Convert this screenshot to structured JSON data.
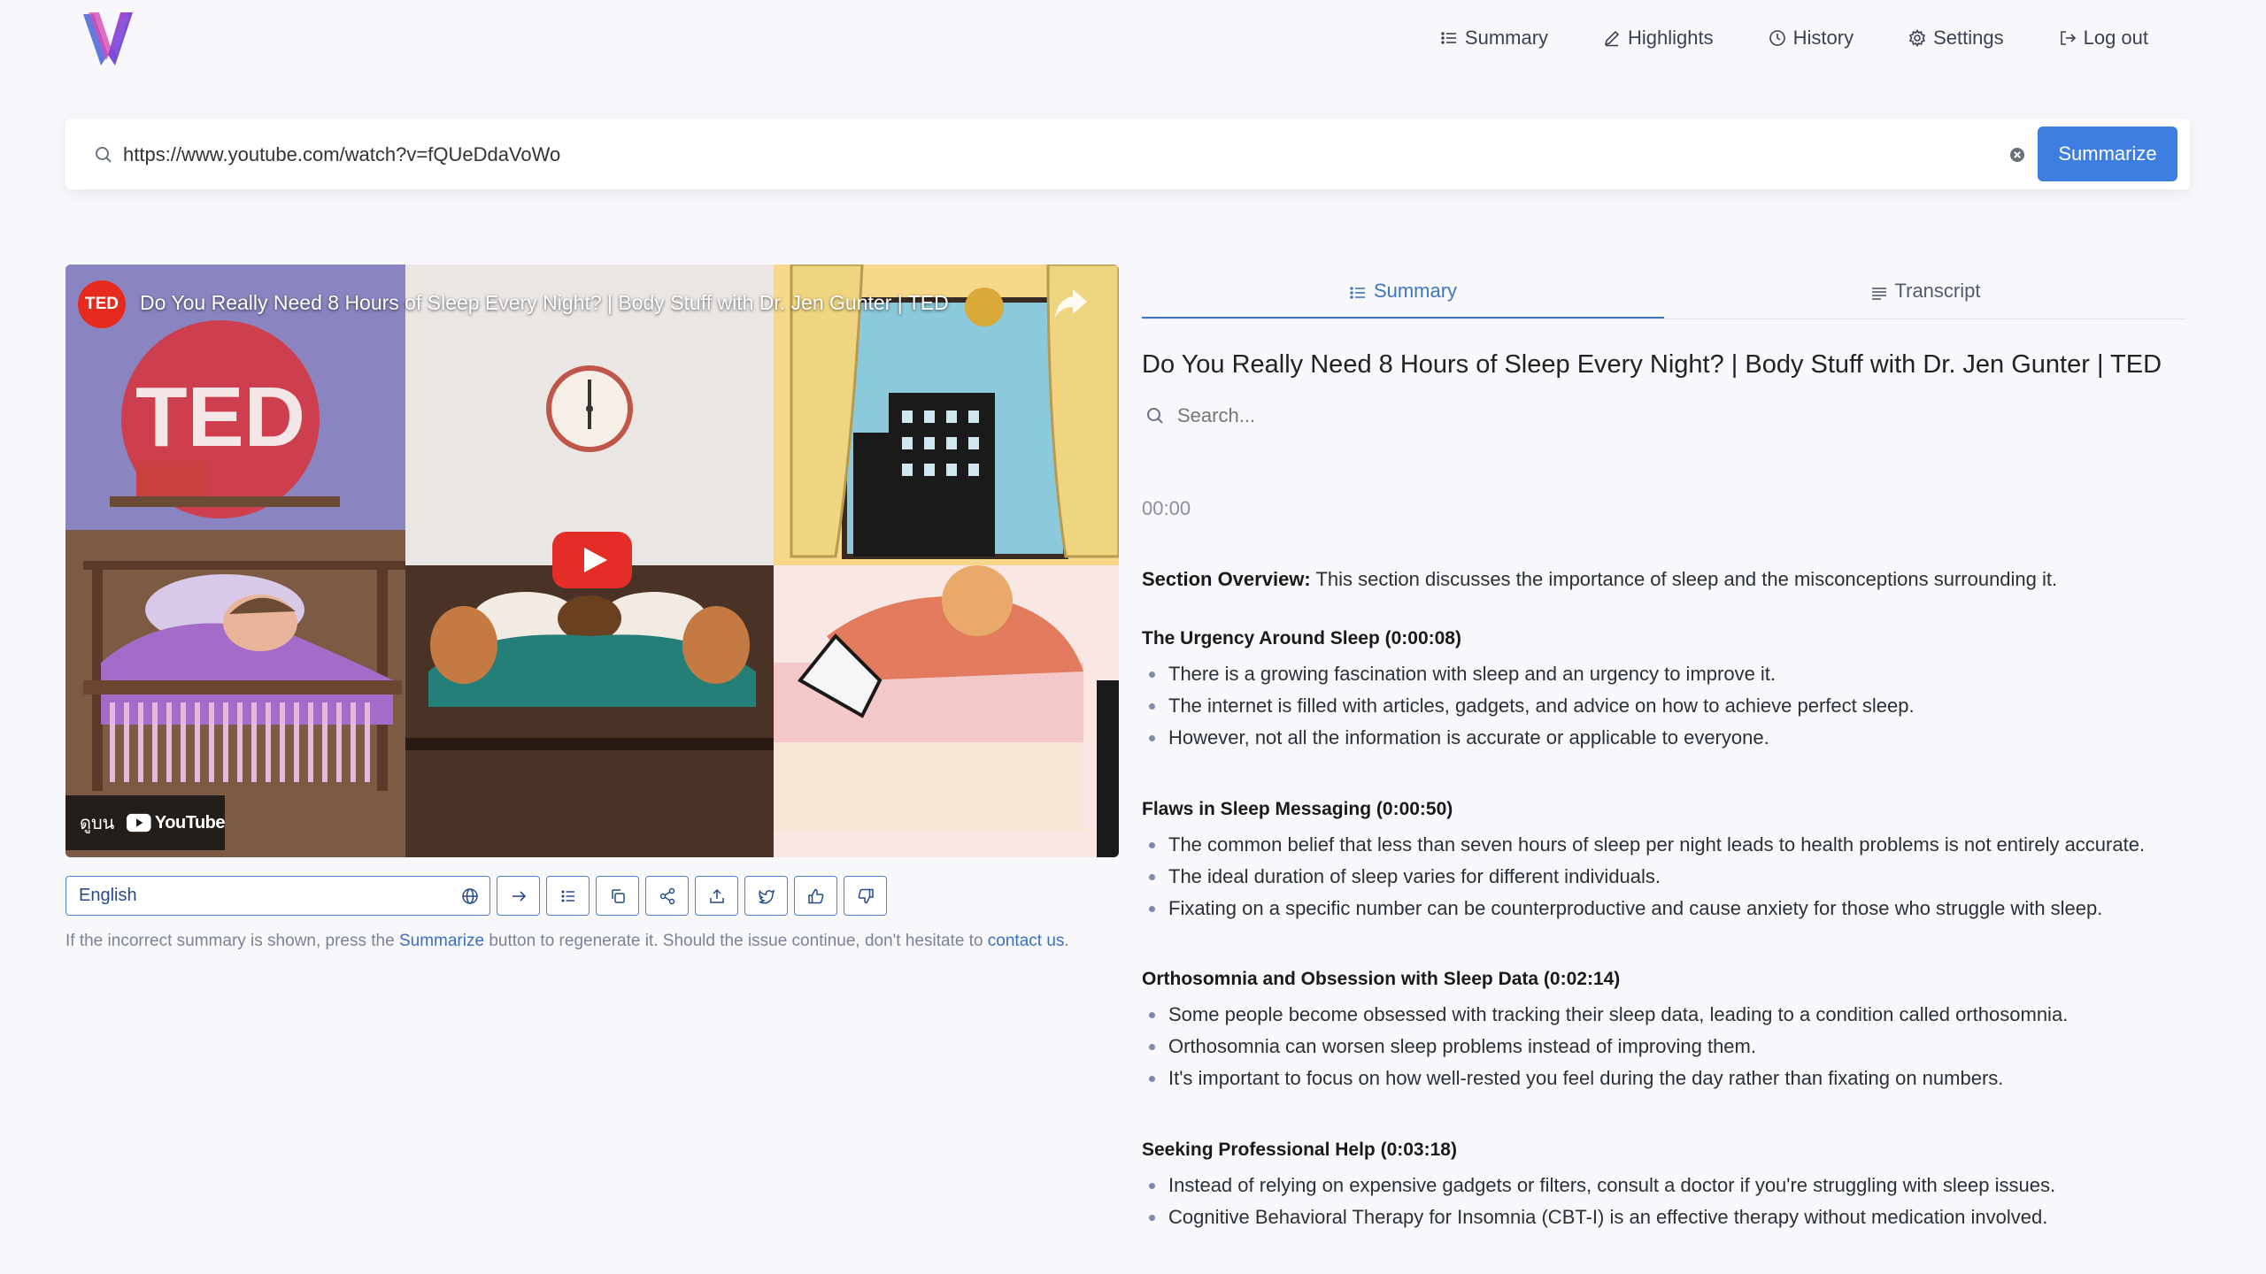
{
  "nav": {
    "items": [
      {
        "label": "Summary",
        "icon": "list-icon"
      },
      {
        "label": "Highlights",
        "icon": "pencil-icon"
      },
      {
        "label": "History",
        "icon": "clock-icon"
      },
      {
        "label": "Settings",
        "icon": "gear-icon"
      },
      {
        "label": "Log out",
        "icon": "logout-icon"
      }
    ]
  },
  "search": {
    "url_value": "https://www.youtube.com/watch?v=fQUeDdaVoWo",
    "button_label": "Summarize"
  },
  "video": {
    "title": "Do You Really Need 8 Hours of Sleep Every Night? | Body Stuff with Dr. Jen Gunter | TED",
    "channel_badge": "TED",
    "watch_on_label": "ดูบน",
    "platform_label": "YouTube"
  },
  "toolbar": {
    "language": "English",
    "buttons": [
      "arrow-right-icon",
      "list-icon",
      "copy-icon",
      "share-icon",
      "upload-icon",
      "twitter-icon",
      "thumbs-up-icon",
      "thumbs-down-icon"
    ]
  },
  "notice": {
    "part1": "If the incorrect summary is shown, press the ",
    "summarize_link": "Summarize",
    "part2": " button to regenerate it. Should the issue continue, don't hesitate to ",
    "contact_link": "contact us",
    "part3": "."
  },
  "tabs": {
    "summary": "Summary",
    "transcript": "Transcript"
  },
  "summary": {
    "title": "Do You Really Need 8 Hours of Sleep Every Night? | Body Stuff with Dr. Jen Gunter | TED",
    "search_placeholder": "Search...",
    "timestamp": "00:00",
    "overview_label": "Section Overview:",
    "overview_text": " This section discusses the importance of sleep and the misconceptions surrounding it.",
    "sections": [
      {
        "heading": "The Urgency Around Sleep (0:00:08)",
        "bullets": [
          "There is a growing fascination with sleep and an urgency to improve it.",
          "The internet is filled with articles, gadgets, and advice on how to achieve perfect sleep.",
          "However, not all the information is accurate or applicable to everyone."
        ]
      },
      {
        "heading": "Flaws in Sleep Messaging (0:00:50)",
        "bullets": [
          "The common belief that less than seven hours of sleep per night leads to health problems is not entirely accurate.",
          "The ideal duration of sleep varies for different individuals.",
          "Fixating on a specific number can be counterproductive and cause anxiety for those who struggle with sleep."
        ]
      },
      {
        "heading": "Orthosomnia and Obsession with Sleep Data (0:02:14)",
        "bullets": [
          "Some people become obsessed with tracking their sleep data, leading to a condition called orthosomnia.",
          "Orthosomnia can worsen sleep problems instead of improving them.",
          "It's important to focus on how well-rested you feel during the day rather than fixating on numbers."
        ]
      },
      {
        "heading": "Seeking Professional Help (0:03:18)",
        "bullets": [
          "Instead of relying on expensive gadgets or filters, consult a doctor if you're struggling with sleep issues.",
          "Cognitive Behavioral Therapy for Insomnia (CBT-I) is an effective therapy without medication involved."
        ]
      }
    ]
  },
  "colors": {
    "accent": "#3d7ee0",
    "link": "#3a6ebd",
    "background": "#f8f8fc"
  }
}
